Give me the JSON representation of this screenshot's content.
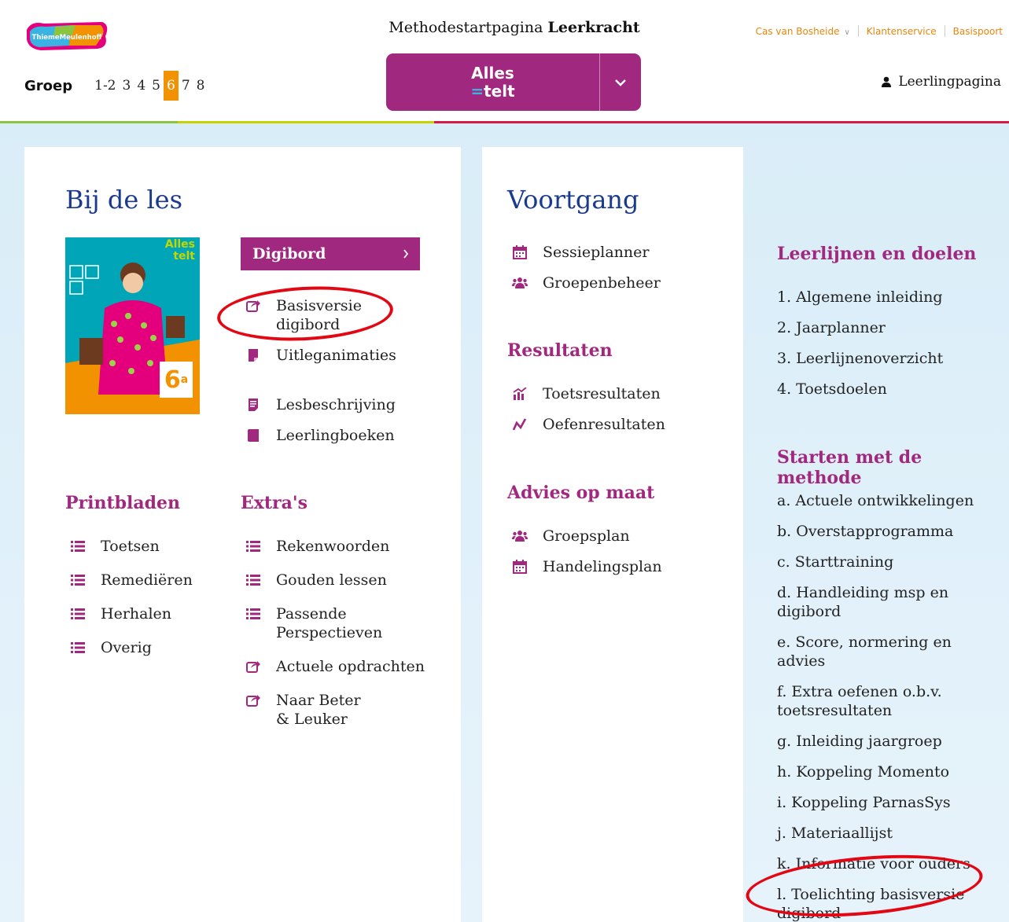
{
  "header": {
    "logo_text": "ThiemeMeulenhoff",
    "title_prefix": "Methodestartpagina",
    "title_bold": "Leerkracht",
    "brand_line1": "Alles",
    "brand_line2": "telt",
    "groep_label": "Groep",
    "groepen": [
      "1-2",
      "3",
      "4",
      "5",
      "6",
      "7",
      "8"
    ],
    "active_groep": "6",
    "user_name": "Cas van Bosheide",
    "customer_service": "Klantenservice",
    "basispoort": "Basispoort",
    "leerling_link": "Leerlingpagina"
  },
  "bij_de_les": {
    "title": "Bij de les",
    "cover_brand_line1": "Alles",
    "cover_brand_line2": "telt",
    "cover_grade": "6",
    "cover_grade_sup": "a",
    "digibord_label": "Digibord",
    "items": [
      {
        "label": "Basisversie digibord",
        "icon": "external-link-icon"
      },
      {
        "label": "Uitleganimaties",
        "icon": "note-icon"
      },
      {
        "label": "Lesbeschrijving",
        "icon": "document-icon"
      },
      {
        "label": "Leerlingboeken",
        "icon": "book-icon"
      }
    ],
    "printbladen_title": "Printbladen",
    "printbladen": [
      "Toetsen",
      "Remediëren",
      "Herhalen",
      "Overig"
    ],
    "extras_title": "Extra's",
    "extras": [
      {
        "label": "Rekenwoorden",
        "icon": "list-icon"
      },
      {
        "label": "Gouden lessen",
        "icon": "list-icon"
      },
      {
        "label": "Passende Perspectieven",
        "icon": "list-icon"
      },
      {
        "label": "Actuele opdrachten",
        "icon": "external-link-icon"
      },
      {
        "label": "Naar Beter & Leuker",
        "icon": "external-link-icon"
      }
    ]
  },
  "voortgang": {
    "title": "Voortgang",
    "items": [
      "Sessieplanner",
      "Groepenbeheer"
    ],
    "resultaten_title": "Resultaten",
    "resultaten": [
      "Toetsresultaten",
      "Oefenresultaten"
    ],
    "advies_title": "Advies op maat",
    "advies": [
      "Groepsplan",
      "Handelingsplan"
    ]
  },
  "leerlijnen": {
    "title": "Leerlijnen en doelen",
    "items": [
      "1. Algemene inleiding",
      "2. Jaarplanner",
      "3. Leerlijnenoverzicht",
      "4. Toetsdoelen"
    ]
  },
  "starten": {
    "title": "Starten met de methode",
    "items": [
      "a. Actuele ontwikkelingen",
      "b. Overstapprogramma",
      "c. Starttraining",
      "d. Handleiding msp en digibord",
      "e. Score, normering en advies",
      "f. Extra oefenen o.b.v. toetsresultaten",
      "g. Inleiding jaargroep",
      "h. Koppeling Momento",
      "i. Koppeling ParnasSys",
      "j. Materiaallijst",
      "k. Informatie voor ouders",
      "l. Toelichting basisversie digibord"
    ]
  },
  "colors": {
    "purple": "#a1287f",
    "orange": "#f39200",
    "navy": "#1a3a8e",
    "annotation_red": "#e30613"
  }
}
